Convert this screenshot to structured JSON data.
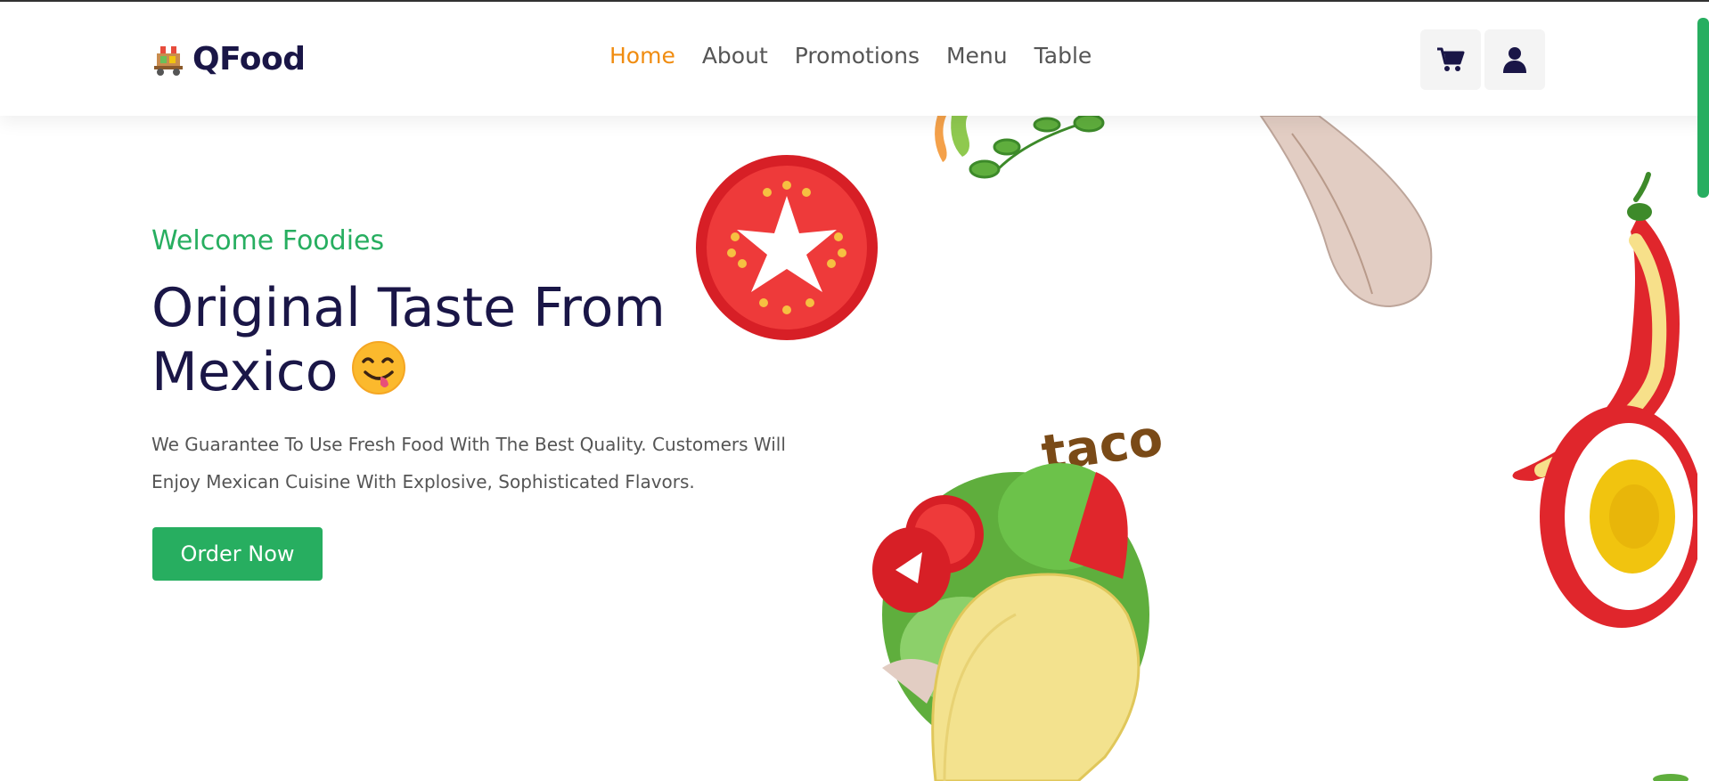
{
  "brand": {
    "name": "QFood",
    "icon": "food-cart-icon"
  },
  "nav": {
    "items": [
      {
        "label": "Home",
        "active": true
      },
      {
        "label": "About",
        "active": false
      },
      {
        "label": "Promotions",
        "active": false
      },
      {
        "label": "Menu",
        "active": false
      },
      {
        "label": "Table",
        "active": false
      }
    ],
    "cart_icon": "cart-icon",
    "user_icon": "user-icon"
  },
  "hero": {
    "welcome": "Welcome Foodies",
    "headline_line1": "Original Taste From",
    "headline_line2": "Mexico",
    "description": "We Guarantee To Use Fresh Food With The Best Quality. Customers Will Enjoy Mexican Cuisine With Explosive, Sophisticated Flavors.",
    "cta_label": "Order Now",
    "illustration_text": "taco"
  },
  "colors": {
    "accent": "#27ae60",
    "active_nav": "#f08c10",
    "heading": "#1a1647",
    "body_text": "#555555"
  }
}
